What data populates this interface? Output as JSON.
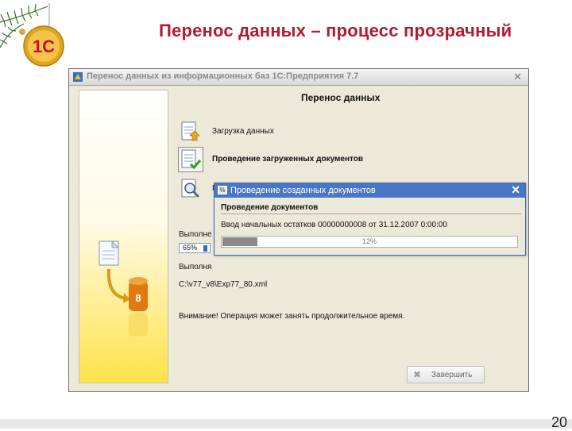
{
  "slide": {
    "title": "Перенос данных – процесс прозрачный",
    "page_number": "20",
    "logo_text": "1С"
  },
  "window": {
    "title": "Перенос данных из информационных баз 1С:Предприятия 7.7",
    "heading": "Перенос данных",
    "steps": [
      {
        "label": "Загрузка данных",
        "icon": "document-arrow-icon",
        "active": false
      },
      {
        "label": "Проведение загруженных документов",
        "icon": "document-check-icon",
        "active": true
      },
      {
        "label": "П",
        "icon": "magnifier-icon",
        "active": false
      }
    ],
    "status_label_1": "Выполне",
    "progress_small": "65%",
    "progress_small_value": 0.65,
    "status_label_2": "Выполня",
    "file_path": "C:\\v77_v8\\Exp77_80.xml",
    "warning": "Внимание! Операция может занять продолжительное время.",
    "finish_button": "Завершить"
  },
  "dialog": {
    "title": "Проведение созданных документов",
    "heading": "Проведение документов",
    "detail": "Ввод начальных остатков 00000000008 от 31.12.2007 0:00:00",
    "progress_label": "12%",
    "progress_value": 0.12
  },
  "colors": {
    "title_red": "#b01c2e",
    "dialog_blue": "#4a76c8",
    "panel_yellow": "#ffe24a"
  }
}
